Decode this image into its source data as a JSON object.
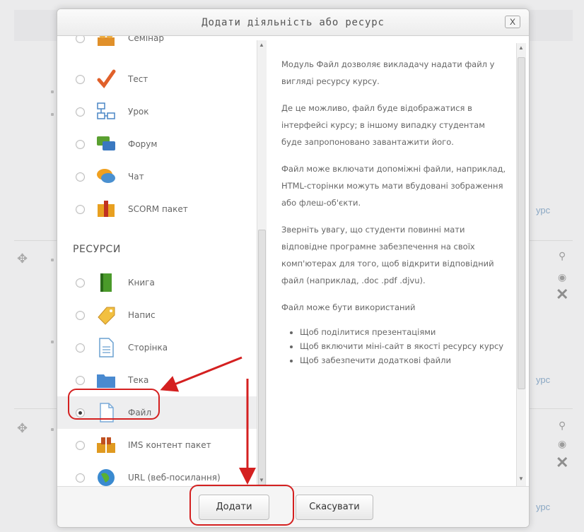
{
  "background": {
    "links": [
      "урс",
      "урс",
      "урс"
    ]
  },
  "dialog": {
    "title": "Додати діяльність або ресурс",
    "close_label": "X"
  },
  "activities": [
    {
      "label": "Семінар",
      "icon": "seminar-icon"
    },
    {
      "label": "Тест",
      "icon": "quiz-icon"
    },
    {
      "label": "Урок",
      "icon": "lesson-icon"
    },
    {
      "label": "Форум",
      "icon": "forum-icon"
    },
    {
      "label": "Чат",
      "icon": "chat-icon"
    },
    {
      "label": "SCORM пакет",
      "icon": "scorm-icon"
    }
  ],
  "resources_header": "РЕСУРСИ",
  "resources": [
    {
      "label": "Книга",
      "icon": "book-icon"
    },
    {
      "label": "Напис",
      "icon": "label-icon"
    },
    {
      "label": "Сторінка",
      "icon": "page-icon"
    },
    {
      "label": "Тека",
      "icon": "folder-icon"
    },
    {
      "label": "Файл",
      "icon": "file-icon",
      "selected": true
    },
    {
      "label": "IMS контент пакет",
      "icon": "ims-icon"
    },
    {
      "label": "URL (веб-посилання)",
      "icon": "url-icon"
    }
  ],
  "description": {
    "p1": "Модуль Файл дозволяє викладачу надати файл у вигляді ресурсу курсу.",
    "p2": "Де це можливо, файл буде відображатися в інтерфейсі курсу; в іншому випадку студентам буде запропоновано завантажити його.",
    "p3": "Файл може включати допоміжні файли, наприклад, HTML-сторінки можуть мати вбудовані зображення або флеш-об'єкти.",
    "p4": "Зверніть увагу, що студенти повинні мати відповідне програмне забезпечення на своїх комп'ютерах для того, щоб відкрити відповідний файл (наприклад, .doc .pdf .djvu).",
    "p5": "Файл може бути використаний",
    "bullets": [
      "Щоб поділитися презентаціями",
      "Щоб включити міні-сайт в якості ресурсу курсу",
      "Щоб забезпечити додаткові файли"
    ]
  },
  "footer": {
    "add_label": "Додати",
    "cancel_label": "Скасувати"
  },
  "colors": {
    "annotation": "#d42020"
  }
}
